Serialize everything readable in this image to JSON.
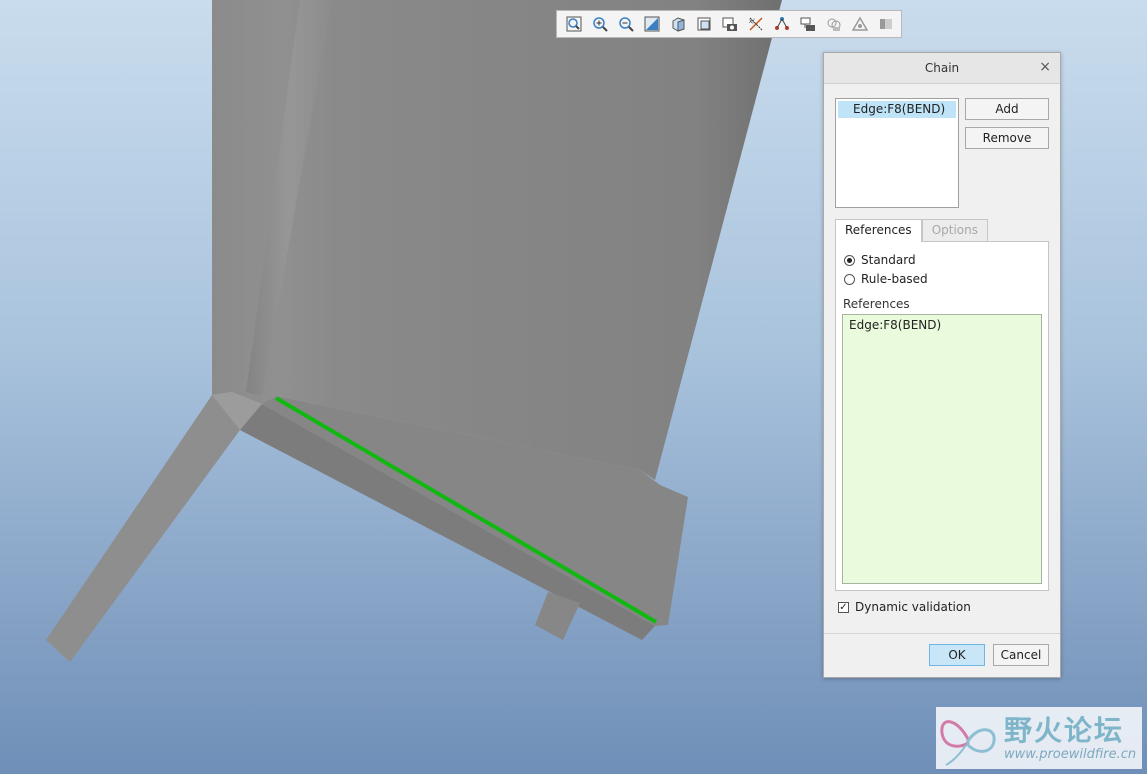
{
  "toolbar": {
    "tools": [
      {
        "name": "refit-icon"
      },
      {
        "name": "zoom-in-icon"
      },
      {
        "name": "zoom-out-icon"
      },
      {
        "name": "repaint-icon"
      },
      {
        "name": "display-style-icon"
      },
      {
        "name": "saved-orientations-icon"
      },
      {
        "name": "view-manager-icon"
      },
      {
        "name": "datum-display-icon"
      },
      {
        "name": "annotation-display-icon"
      },
      {
        "name": "spin-center-icon"
      },
      {
        "name": "appearance-icon"
      },
      {
        "name": "simulation-display-icon"
      },
      {
        "name": "section-icon"
      }
    ]
  },
  "dialog": {
    "title": "Chain",
    "close_glyph": "×",
    "chain_items": [
      "Edge:F8(BEND)"
    ],
    "add_label": "Add",
    "remove_label": "Remove",
    "tabs": [
      "References",
      "Options"
    ],
    "active_tab": "References",
    "radio_standard": "Standard",
    "radio_rule_based": "Rule-based",
    "selected_radio": "Standard",
    "references_label": "References",
    "references": [
      "Edge:F8(BEND)"
    ],
    "dynamic_validation_label": "Dynamic validation",
    "dynamic_validation_checked": true,
    "check_glyph": "✓",
    "ok_label": "OK",
    "cancel_label": "Cancel"
  },
  "model": {
    "selected_edge_color": "#11b811",
    "part_color": "#8a8a8a"
  },
  "watermark": {
    "title": "野火论坛",
    "url": "www.proewildfire.cn"
  },
  "colors": {
    "background_top": "#c9dced",
    "background_bottom": "#6f8fb8",
    "selection_highlight": "#bfe3f7",
    "references_background": "#e9fbdc",
    "ok_button": "#c9e6f8"
  }
}
